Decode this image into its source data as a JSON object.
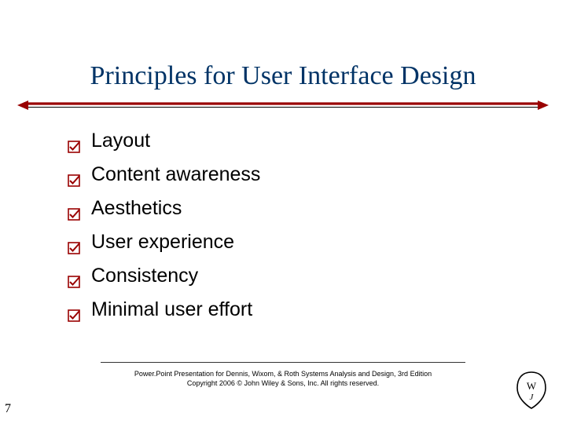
{
  "slide": {
    "title": "Principles for User Interface Design",
    "bullets": [
      {
        "label": "Layout"
      },
      {
        "label": "Content awareness"
      },
      {
        "label": "Aesthetics"
      },
      {
        "label": "User experience"
      },
      {
        "label": "Consistency"
      },
      {
        "label": "Minimal user effort"
      }
    ],
    "footer": {
      "line1": "Power.Point Presentation for Dennis, Wixom, & Roth Systems Analysis and Design, 3rd Edition",
      "line2": "Copyright 2006 © John Wiley & Sons, Inc.  All rights reserved."
    },
    "slide_number": "7",
    "colors": {
      "title": "#003366",
      "accent_red": "#990000",
      "accent_bullet": "#990000"
    }
  }
}
